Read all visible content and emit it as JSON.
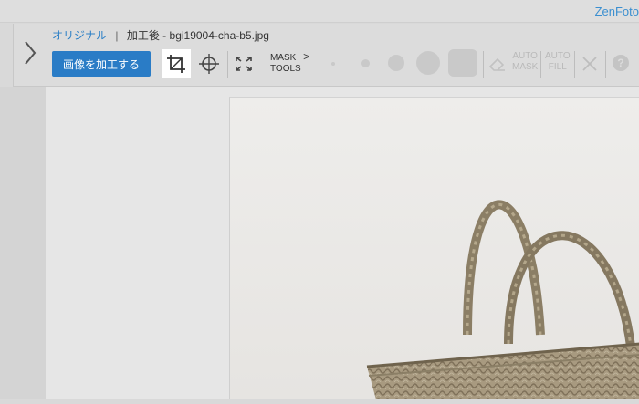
{
  "brand": "ZenFoto",
  "breadcrumb": {
    "original_label": "オリジナル",
    "separator": "|",
    "edited_label": "加工後 -",
    "filename": "bgi19004-cha-b5.jpg"
  },
  "toolbar": {
    "process_button_label": "画像を加工する",
    "mask_tools_label_line1": "MASK",
    "mask_tools_label_line2": "TOOLS",
    "mask_tools_chevron": ">",
    "auto_mask_line1": "AUTO",
    "auto_mask_line2": "MASK",
    "auto_fill_line1": "AUTO",
    "auto_fill_line2": "FILL",
    "help_label": "?"
  },
  "icons": {
    "expand": "chevron-right-icon",
    "crop": "crop-icon",
    "target": "crosshair-icon",
    "fit": "fit-arrows-icon",
    "eraser": "eraser-icon",
    "close": "close-icon",
    "help": "help-icon"
  },
  "colors": {
    "accent": "#2a7cc6",
    "brand": "#3b8fd0"
  }
}
